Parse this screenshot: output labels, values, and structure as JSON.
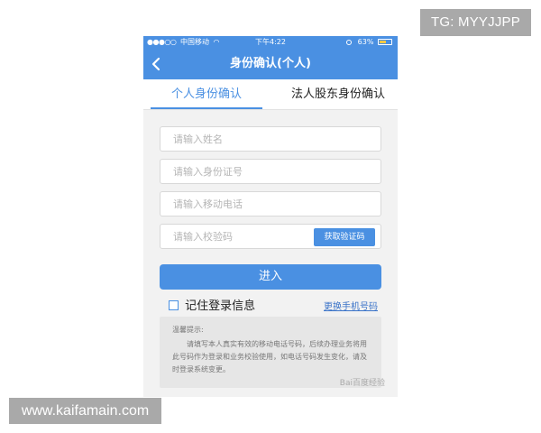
{
  "status_bar": {
    "carrier": "中国移动",
    "time": "下午4:22",
    "battery": "63%",
    "battery_level": 0.63
  },
  "nav": {
    "title": "身份确认(个人)",
    "back_icon": "chevron-left-icon"
  },
  "tabs": [
    {
      "label": "个人身份确认",
      "active": true
    },
    {
      "label": "法人股东身份确认",
      "active": false
    }
  ],
  "form": {
    "name_placeholder": "请输入姓名",
    "id_placeholder": "请输入身份证号",
    "phone_placeholder": "请输入移动电话",
    "code_placeholder": "请输入校验码",
    "get_code_label": "获取验证码",
    "submit_label": "进入",
    "remember_label": "记住登录信息",
    "change_phone_label": "更换手机号码"
  },
  "tips": {
    "title": "温馨提示:",
    "body": "请填写本人真实有效的移动电话号码，后续办理业务将用此号码作为登录和业务校验使用，如电话号码发生变化，请及时登录系统变更。"
  },
  "watermarks": {
    "top": "TG: MYYJJPP",
    "bottom": "www.kaifamain.com",
    "baidu": "Bai百度经验"
  },
  "colors": {
    "brand_blue": "#4a90e2",
    "form_background": "#f2f2f2",
    "tips_background": "#e6e6e6",
    "watermark_gray": "#a9a9a9",
    "battery_yellow": "#f6c945"
  }
}
